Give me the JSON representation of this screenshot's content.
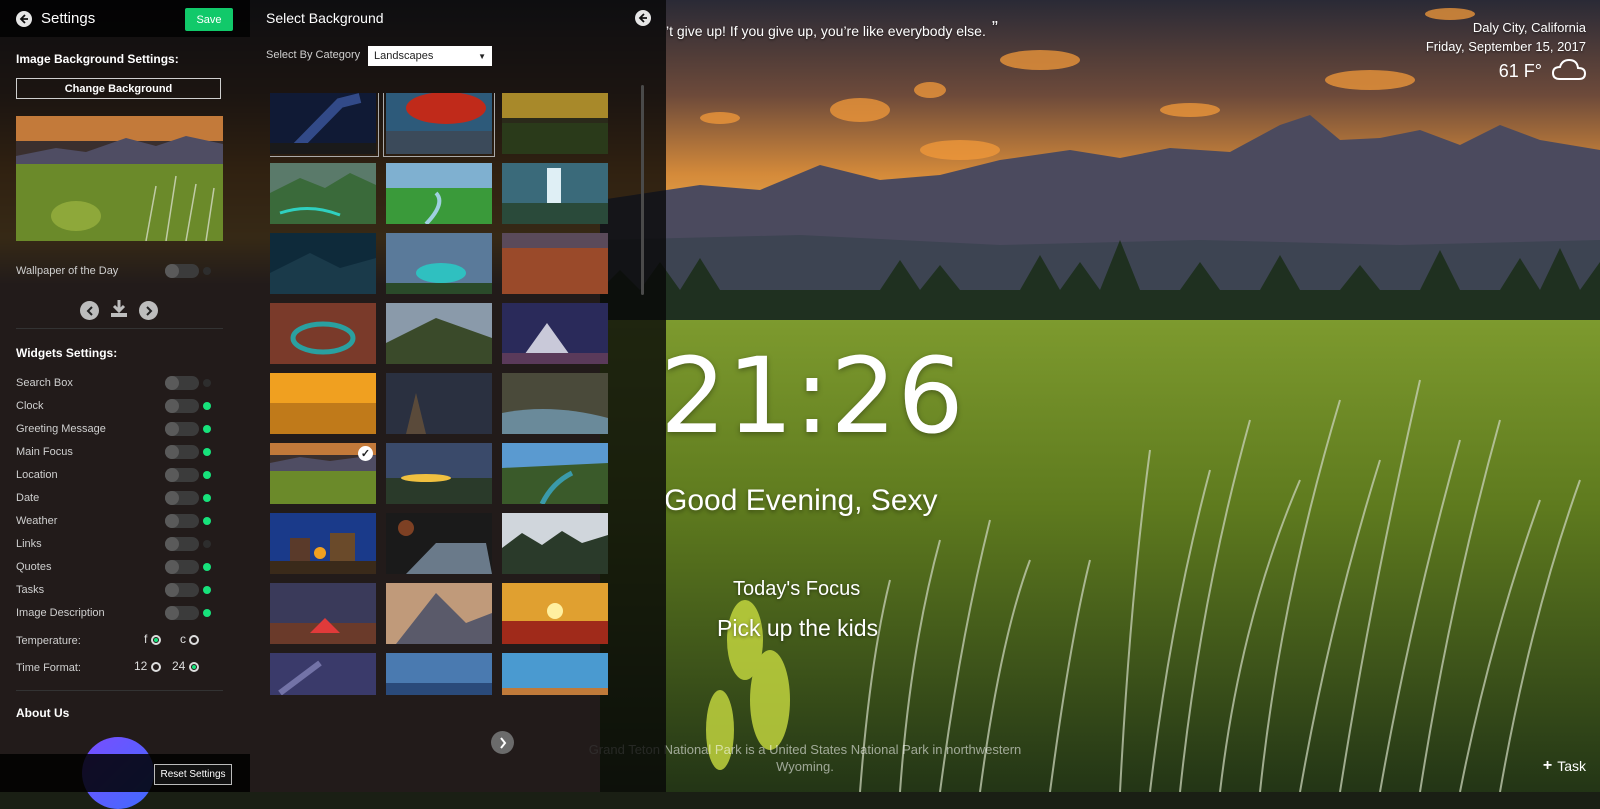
{
  "quote": {
    "text": "’t give up! If you give up, you’re like everybody else.",
    "close_mark": "”"
  },
  "location": {
    "city": "Daly City, California",
    "date": "Friday, September 15, 2017"
  },
  "weather": {
    "temp": "61 F°",
    "icon": "cloud-icon"
  },
  "clock": {
    "time": "21:26"
  },
  "greeting": "Good Evening, Sexy",
  "focus": {
    "label": "Today's Focus",
    "text": "Pick up the kids"
  },
  "image_description": "Grand Teton National Park is a United States National Park in northwestern Wyoming.",
  "task_button": {
    "icon": "+",
    "label": "Task"
  },
  "settings": {
    "title": "Settings",
    "save_label": "Save",
    "image_section": "Image Background Settings:",
    "change_bg_label": "Change Background",
    "wallpaper_of_day": "Wallpaper of the Day",
    "widgets_section": "Widgets Settings:",
    "widgets": [
      {
        "label": "Search Box",
        "on": false
      },
      {
        "label": "Clock",
        "on": true
      },
      {
        "label": "Greeting Message",
        "on": true
      },
      {
        "label": "Main Focus",
        "on": true
      },
      {
        "label": "Location",
        "on": true
      },
      {
        "label": "Date",
        "on": true
      },
      {
        "label": "Weather",
        "on": true
      },
      {
        "label": "Links",
        "on": false
      },
      {
        "label": "Quotes",
        "on": true
      },
      {
        "label": "Tasks",
        "on": true
      },
      {
        "label": "Image Description",
        "on": true
      }
    ],
    "temperature": {
      "label": "Temperature:",
      "opt1": "f",
      "opt2": "c",
      "selected": "f"
    },
    "time_format": {
      "label": "Time Format:",
      "opt1": "12",
      "opt2": "24",
      "selected": "24"
    },
    "about_title": "About Us",
    "reset_label": "Reset Settings"
  },
  "gallery": {
    "title": "Select Background",
    "category_label": "Select By Category",
    "category_value": "Landscapes"
  },
  "colors": {
    "accent_green": "#17e27b",
    "save_green": "#11c96a"
  }
}
